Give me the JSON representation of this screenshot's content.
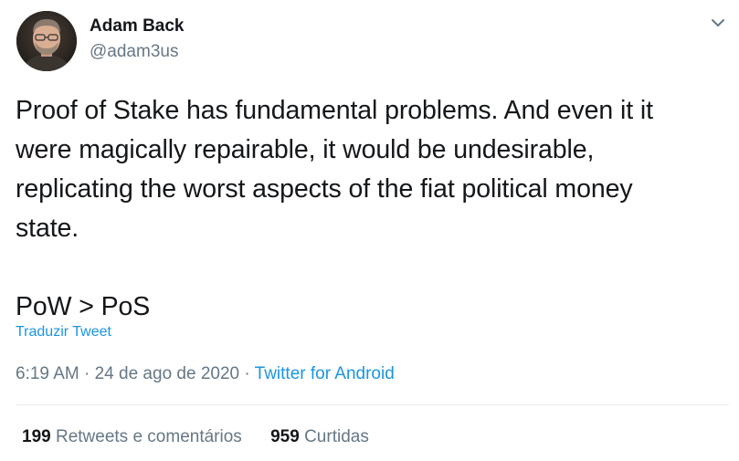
{
  "author": {
    "name": "Adam Back",
    "handle": "@adam3us"
  },
  "tweet": {
    "lines": [
      "Proof of Stake has fundamental problems. And even it it",
      "were magically repairable, it would be undesirable,",
      "replicating the worst aspects of the fiat political money",
      "state."
    ],
    "last_line": "PoW > PoS"
  },
  "translate_label": "Traduzir Tweet",
  "meta": {
    "time": "6:19 AM",
    "separator": " · ",
    "date": "24 de ago de 2020",
    "source": "Twitter for Android"
  },
  "stats": {
    "retweets_count": "199",
    "retweets_label": "Retweets e comentários",
    "likes_count": "959",
    "likes_label": "Curtidas"
  },
  "icons": {
    "caret": "chevron-down-icon",
    "avatar": "avatar"
  },
  "colors": {
    "text": "#14171a",
    "secondary": "#657786",
    "link": "#1b95e0",
    "divider": "#e6ecf0"
  }
}
